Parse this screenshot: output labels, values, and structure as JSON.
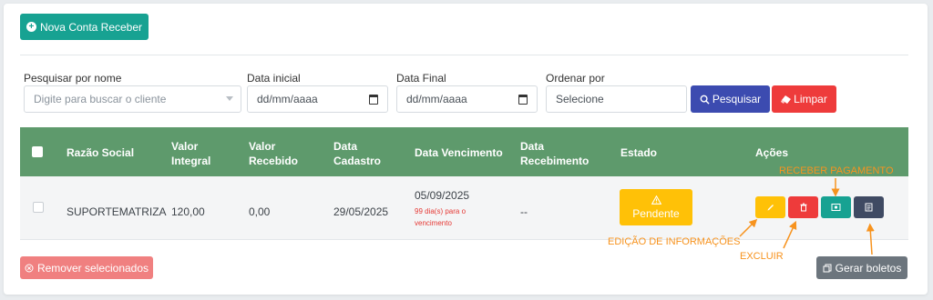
{
  "toolbar": {
    "new_button_label": "Nova Conta Receber"
  },
  "filters": {
    "name_label": "Pesquisar por nome",
    "name_placeholder": "Digite para buscar o cliente",
    "start_date_label": "Data inicial",
    "start_date_value": "dd/mm/aaaa",
    "end_date_label": "Data Final",
    "end_date_value": "dd/mm/aaaa",
    "order_label": "Ordenar por",
    "order_value": "Selecione",
    "search_label": "Pesquisar",
    "clear_label": "Limpar"
  },
  "table": {
    "headers": {
      "razao_social": "Razão Social",
      "valor_integral": [
        "Valor",
        "Integral"
      ],
      "valor_recebido": [
        "Valor",
        "Recebido"
      ],
      "data_cadastro": [
        "Data",
        "Cadastro"
      ],
      "data_vencimento": "Data Vencimento",
      "data_recebimento": [
        "Data",
        "Recebimento"
      ],
      "estado": "Estado",
      "acoes": "Ações"
    },
    "rows": [
      {
        "razao_social": "SUPORTEMATRIZA",
        "valor_integral": "120,00",
        "valor_recebido": "0,00",
        "data_cadastro": "29/05/2025",
        "data_vencimento": "05/09/2025",
        "vencimento_note_1": "99 dia(s) para o",
        "vencimento_note_2": "vencimento",
        "data_recebimento": "--",
        "estado": "Pendente"
      }
    ]
  },
  "footer": {
    "remove_label": "Remover selecionados",
    "boletos_label": "Gerar boletos"
  },
  "annotations": {
    "receber": "RECEBER PAGAMENTO",
    "edicao": "EDIÇÃO DE INFORMAÇÕES",
    "excluir": "EXCLUIR"
  },
  "colors": {
    "new_button": "#17a292",
    "table_header": "#5e9a6c",
    "search_button": "#3c4bb0",
    "clear_button": "#ee3b3b",
    "status_pending": "#ffc107",
    "edit_button": "#ffc107",
    "delete_button": "#ee3b3b",
    "receive_button": "#17a292",
    "boleto_button": "#3f4a63",
    "annotation": "#f7931e"
  }
}
